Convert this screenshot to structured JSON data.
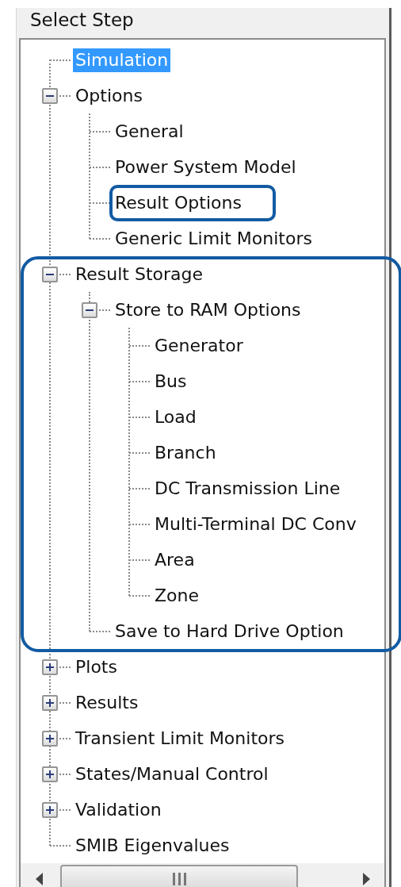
{
  "group": {
    "title": "Select Step"
  },
  "tree": {
    "items": [
      {
        "label": "Simulation",
        "selected": true,
        "highlighted": false
      },
      {
        "label": "Options",
        "selected": false,
        "highlighted": false,
        "expanded": true,
        "children": [
          {
            "label": "General",
            "selected": false,
            "highlighted": false
          },
          {
            "label": "Power System Model",
            "selected": false,
            "highlighted": false
          },
          {
            "label": "Result Options",
            "selected": false,
            "highlighted": true
          },
          {
            "label": "Generic Limit Monitors",
            "selected": false,
            "highlighted": false
          }
        ]
      },
      {
        "label": "Result Storage",
        "selected": false,
        "highlighted": true,
        "expanded": true,
        "children": [
          {
            "label": "Store to RAM Options",
            "selected": false,
            "highlighted": false,
            "expanded": true,
            "children": [
              {
                "label": "Generator",
                "selected": false,
                "highlighted": false
              },
              {
                "label": "Bus",
                "selected": false,
                "highlighted": false
              },
              {
                "label": "Load",
                "selected": false,
                "highlighted": false
              },
              {
                "label": "Branch",
                "selected": false,
                "highlighted": false
              },
              {
                "label": "DC Transmission Line",
                "selected": false,
                "highlighted": false
              },
              {
                "label": "Multi-Terminal DC Conv",
                "selected": false,
                "highlighted": false
              },
              {
                "label": "Area",
                "selected": false,
                "highlighted": false
              },
              {
                "label": "Zone",
                "selected": false,
                "highlighted": false
              }
            ]
          },
          {
            "label": "Save to Hard Drive Option",
            "selected": false,
            "highlighted": false
          }
        ]
      },
      {
        "label": "Plots",
        "selected": false,
        "highlighted": false,
        "expanded": false
      },
      {
        "label": "Results",
        "selected": false,
        "highlighted": false,
        "expanded": false
      },
      {
        "label": "Transient Limit Monitors",
        "selected": false,
        "highlighted": false,
        "expanded": false
      },
      {
        "label": "States/Manual Control",
        "selected": false,
        "highlighted": false,
        "expanded": false
      },
      {
        "label": "Validation",
        "selected": false,
        "highlighted": false,
        "expanded": false
      },
      {
        "label": "SMIB Eigenvalues",
        "selected": false,
        "highlighted": false
      }
    ]
  }
}
